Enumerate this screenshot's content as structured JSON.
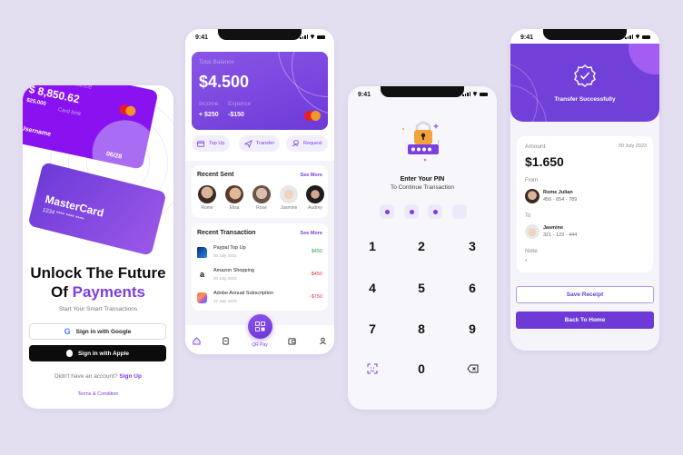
{
  "colors": {
    "background": "#e4dff0",
    "accent": "#7a3fe0",
    "income": "#3aa14b",
    "expense": "#e0344a"
  },
  "status_bar": {
    "time": "9:41"
  },
  "welcome": {
    "credit_card": {
      "title": "Credit Card Balance",
      "balance": "$ 8,850.62",
      "limit_value": "$25.000",
      "limit_label": "Card limit",
      "holder": "Username",
      "expiry": "06/28",
      "brand_icon": "mastercard-logo"
    },
    "debit_card": {
      "brand": "MasterCard",
      "number": "1234 **** **** ****"
    },
    "headline_line1": "Unlock The Future",
    "headline_of": "Of",
    "headline_accent": "Payments",
    "subtitle": "Start Your Smart Transactions",
    "google_button": "Sign in with Google",
    "apple_button": "Sign in with Apple",
    "no_account_text": "Didn't have an account?",
    "signup_link": "Sign Up",
    "terms_link": "Terms & Condition"
  },
  "home": {
    "balance_label": "Total Balance",
    "balance": "$4.500",
    "income_label": "Income",
    "income": "+ $250",
    "expense_label": "Expense",
    "expense": "-$150",
    "actions": [
      {
        "label": "Top Up",
        "icon": "card-plus-icon"
      },
      {
        "label": "Transfer",
        "icon": "send-icon"
      },
      {
        "label": "Request",
        "icon": "request-money-icon"
      }
    ],
    "recent_sent": {
      "title": "Recent Sent",
      "see_more": "See More",
      "people": [
        {
          "name": "Rome"
        },
        {
          "name": "Elisa"
        },
        {
          "name": "Rose"
        },
        {
          "name": "Jasmine"
        },
        {
          "name": "Audrey"
        }
      ]
    },
    "recent_transaction": {
      "title": "Recent Transaction",
      "see_more": "See More",
      "items": [
        {
          "name": "Paypal Top Up",
          "date": "30 July 2023",
          "amount": "$450",
          "type": "income",
          "icon": "paypal-logo"
        },
        {
          "name": "Amazon Shopping",
          "date": "30 July 2023",
          "amount": "-$450",
          "type": "expense",
          "icon": "amazon-logo"
        },
        {
          "name": "Adobe Annual Subscription",
          "date": "27 July 2023",
          "amount": "-$750",
          "type": "expense",
          "icon": "adobe-logo"
        }
      ]
    },
    "tabbar": {
      "items": [
        "home-icon",
        "document-icon",
        "wallet-icon",
        "profile-icon"
      ],
      "qr_label": "QR Pay"
    }
  },
  "pin": {
    "title": "Enter Your PIN",
    "subtitle": "To Continue Transaction",
    "digits_entered": 3,
    "digits_total": 4,
    "keys": [
      "1",
      "2",
      "3",
      "4",
      "5",
      "6",
      "7",
      "8",
      "9",
      "face-id",
      "0",
      "backspace"
    ]
  },
  "success": {
    "title": "Transfer Successfully",
    "amount_label": "Amount",
    "date": "30 July 2023",
    "amount": "$1.650",
    "from_label": "From",
    "from_name": "Rome Julian",
    "from_account": "456 - 654 - 789",
    "to_label": "To",
    "to_name": "Jasmine",
    "to_account": "321 - 123 - 444",
    "note_label": "Note",
    "note": "-",
    "save_button": "Save Receipt",
    "home_button": "Back To Home"
  }
}
